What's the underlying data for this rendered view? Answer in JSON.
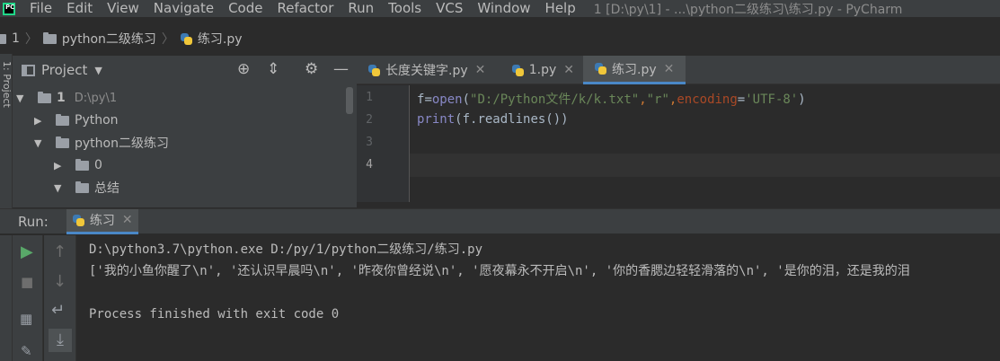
{
  "menubar": {
    "logo_text": "PC",
    "items": [
      "File",
      "Edit",
      "View",
      "Navigate",
      "Code",
      "Refactor",
      "Run",
      "Tools",
      "VCS",
      "Window",
      "Help"
    ],
    "window_title": "1 [D:\\py\\1] - ...\\python二级练习\\练习.py - PyCharm"
  },
  "breadcrumb": {
    "items": [
      "1",
      "python二级练习",
      "练习.py"
    ]
  },
  "left_strip": {
    "label": "1: Project"
  },
  "project": {
    "title": "Project",
    "tree": [
      {
        "label": "1",
        "path": "D:\\py\\1",
        "expanded": true
      },
      {
        "label": "Python",
        "expanded": false
      },
      {
        "label": "python二级练习",
        "expanded": true
      },
      {
        "label": "0",
        "expanded": false
      },
      {
        "label": "总结",
        "expanded": true
      }
    ]
  },
  "editor": {
    "tabs": [
      {
        "label": "长度关键字.py",
        "active": false
      },
      {
        "label": "1.py",
        "active": false
      },
      {
        "label": "练习.py",
        "active": true
      }
    ],
    "line_numbers": [
      "1",
      "2",
      "3",
      "4"
    ],
    "code": {
      "line1": {
        "var": "f",
        "eq": "=",
        "fn": "open",
        "p1": "(",
        "s1": "\"D:/Python文件/k/k.txt\"",
        "c1": ",",
        "s2": "\"r\"",
        "c2": ",",
        "kw": "encoding",
        "eq2": "=",
        "s3": "'UTF-8'",
        "p2": ")"
      },
      "line2": {
        "fn": "print",
        "rest": "(f.readlines())"
      }
    }
  },
  "run": {
    "label": "Run:",
    "tab_label": "练习",
    "console_lines": [
      "D:\\python3.7\\python.exe D:/py/1/python二级练习/练习.py",
      "['我的小鱼你醒了\\n', '还认识早晨吗\\n', '昨夜你曾经说\\n', '愿夜幕永不开启\\n', '你的香腮边轻轻滑落的\\n', '是你的泪，还是我的泪",
      "",
      "Process finished with exit code 0"
    ]
  },
  "colors": {
    "accent": "#4a88c7",
    "run_green": "#59a869",
    "string": "#6a8759",
    "keyword_arg": "#aa4926",
    "operator": "#cc7832",
    "builtin": "#8888c6"
  }
}
